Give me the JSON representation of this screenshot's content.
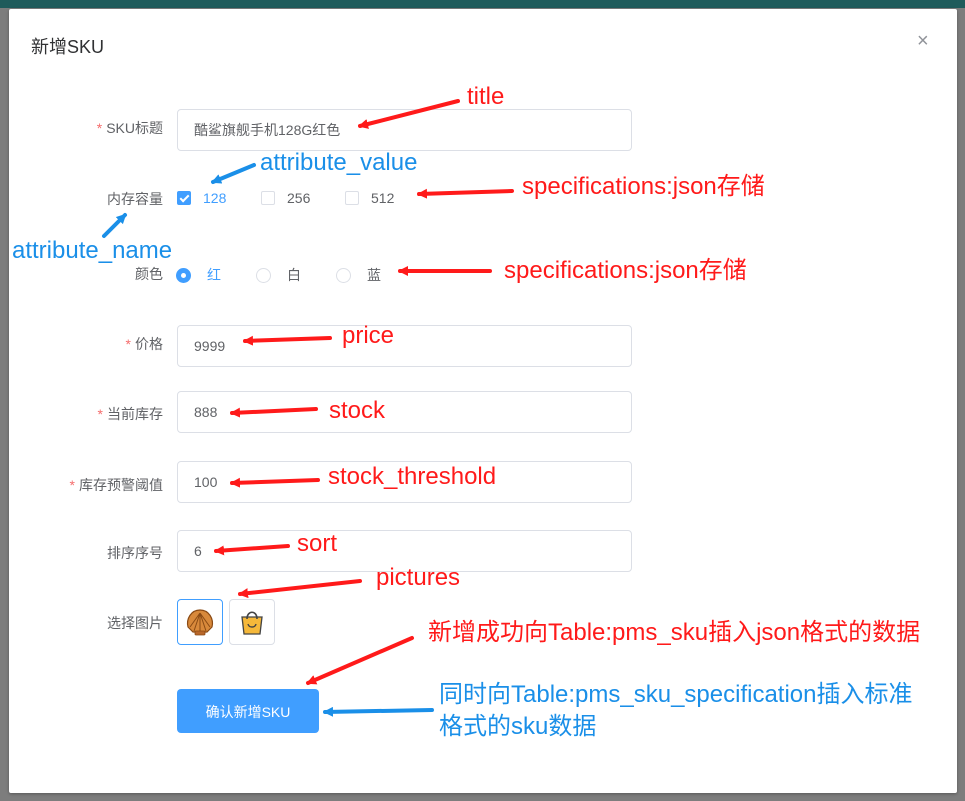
{
  "dialog": {
    "title": "新增SKU",
    "close_icon": "×"
  },
  "form": {
    "sku_title": {
      "label": "SKU标题",
      "required": true,
      "value": "酷鲨旗舰手机128G红色"
    },
    "memory": {
      "label": "内存容量",
      "options": [
        {
          "label": "128",
          "checked": true
        },
        {
          "label": "256",
          "checked": false
        },
        {
          "label": "512",
          "checked": false
        }
      ]
    },
    "color": {
      "label": "颜色",
      "options": [
        {
          "label": "红",
          "checked": true
        },
        {
          "label": "白",
          "checked": false
        },
        {
          "label": "蓝",
          "checked": false
        }
      ]
    },
    "price": {
      "label": "价格",
      "required": true,
      "value": "9999"
    },
    "stock": {
      "label": "当前库存",
      "required": true,
      "value": "888"
    },
    "stock_threshold": {
      "label": "库存预警阈值",
      "required": true,
      "value": "100"
    },
    "sort": {
      "label": "排序序号",
      "value": "6"
    },
    "pictures": {
      "label": "选择图片",
      "items": [
        "shell-icon",
        "shopping-bag-icon"
      ]
    },
    "submit_label": "确认新增SKU"
  },
  "annotations": {
    "title": "title",
    "attribute_value": "attribute_value",
    "attribute_name": "attribute_name",
    "specifications_1": "specifications:json存储",
    "specifications_2": "specifications:json存储",
    "price": "price",
    "stock": "stock",
    "stock_threshold": "stock_threshold",
    "sort": "sort",
    "pictures": "pictures",
    "insert_sku": "新增成功向Table:pms_sku插入json格式的数据",
    "insert_spec_line1": "同时向Table:pms_sku_specification插入标准",
    "insert_spec_line2": "格式的sku数据"
  },
  "colors": {
    "primary": "#409eff",
    "required": "#f56c6c",
    "annotation_red": "#ff1a1a",
    "annotation_blue": "#1a8fe8"
  }
}
